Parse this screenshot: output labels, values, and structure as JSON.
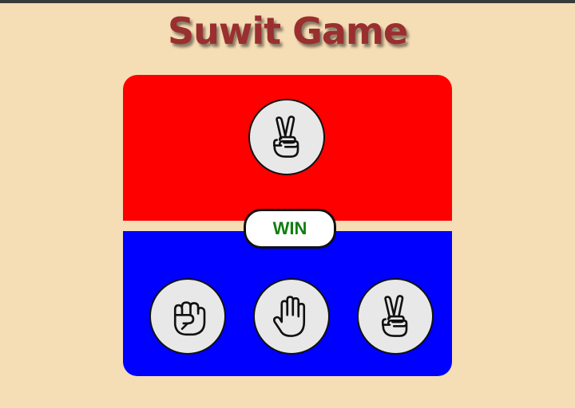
{
  "title": "Suwit Game",
  "colors": {
    "background": "#f5ddb5",
    "title": "#9a2f2f",
    "opponent_area": "#ff0000",
    "player_area": "#0000ff",
    "result_text": "#0f7f0f"
  },
  "opponent": {
    "choice_icon": "scissors-hand-icon"
  },
  "result": {
    "label": "WIN"
  },
  "player": {
    "choices": [
      {
        "name": "rock",
        "icon": "rock-fist-icon"
      },
      {
        "name": "paper",
        "icon": "paper-hand-icon"
      },
      {
        "name": "scissors",
        "icon": "scissors-hand-icon"
      }
    ]
  }
}
